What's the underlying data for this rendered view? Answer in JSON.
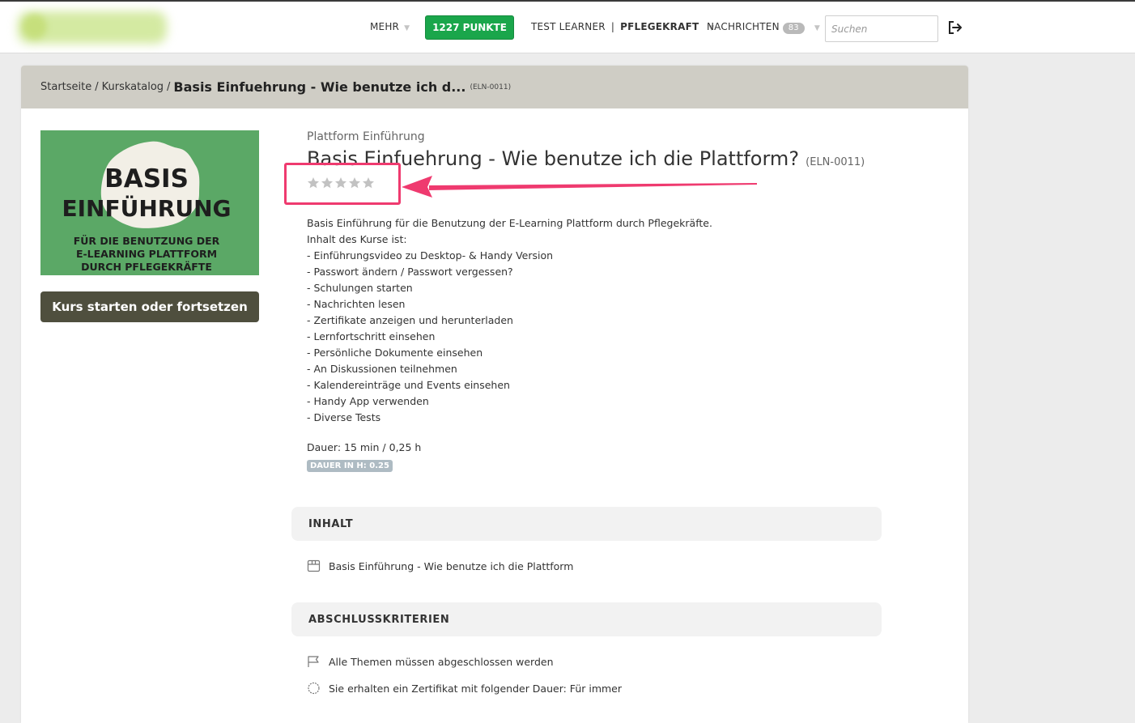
{
  "nav": {
    "more_label": "MEHR",
    "points_label": "1227 PUNKTE",
    "user_name": "TEST LEARNER",
    "user_separator": "|",
    "user_role": "PFLEGEKRAFT",
    "messages_label": "NACHRICHTEN",
    "messages_count": "83",
    "search_placeholder": "Suchen"
  },
  "breadcrumb": {
    "home": "Startseite",
    "separator": "/",
    "catalog": "Kurskatalog",
    "current": "Basis Einfuehrung - Wie benutze ich d...",
    "code": "(ELN-0011)"
  },
  "course_image": {
    "line1": "BASIS",
    "line2": "EINFÜHRUNG",
    "line3": "FÜR DIE BENUTZUNG DER",
    "line4": "E-LEARNING PLATTFORM",
    "line5": "DURCH PFLEGEKRÄFTE",
    "background_color": "#5ba866"
  },
  "start_button_label": "Kurs starten oder fortsetzen",
  "course": {
    "category": "Plattform Einführung",
    "title": "Basis Einfuehrung - Wie benutze ich die Plattform?",
    "code": "(ELN-0011)",
    "rating": 0,
    "rating_max": 5,
    "description": [
      "Basis Einführung für die Benutzung der E-Learning Plattform durch Pflegekräfte.",
      "Inhalt des Kurse ist:",
      "- Einführungsvideo zu Desktop- & Handy Version",
      "- Passwort ändern / Passwort vergessen?",
      "- Schulungen starten",
      "- Nachrichten lesen",
      "- Zertifikate anzeigen und herunterladen",
      "- Lernfortschritt einsehen",
      "- Persönliche Dokumente einsehen",
      "- An Diskussionen teilnehmen",
      "- Kalendereinträge und Events einsehen",
      "- Handy App verwenden",
      "- Diverse Tests"
    ],
    "duration": "Dauer: 15 min / 0,25 h",
    "duration_badge": "DAUER IN H: 0.25"
  },
  "content_section": {
    "header": "INHALT",
    "item": "Basis Einführung - Wie benutze ich die Plattform"
  },
  "criteria_section": {
    "header": "ABSCHLUSSKRITERIEN",
    "item1": "Alle Themen müssen abgeschlossen werden",
    "item2": "Sie erhalten ein Zertifikat mit folgender Dauer: Für immer"
  },
  "colors": {
    "accent_green": "#1aa64b",
    "breadcrumb_bg": "#cfcdc5",
    "start_button": "#4f4f3e",
    "annotation": "#ef3a6f"
  }
}
